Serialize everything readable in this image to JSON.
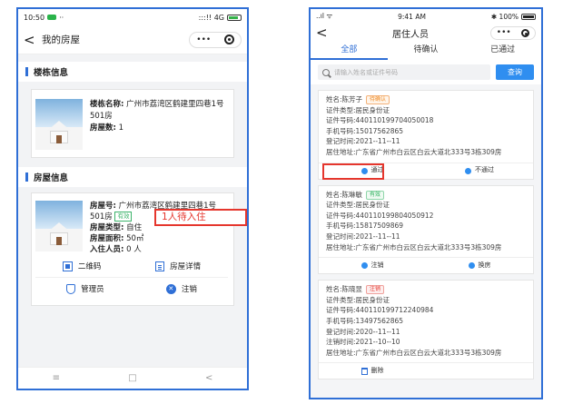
{
  "left": {
    "status": {
      "time": "10:50",
      "dots": "··",
      "signal": ":::!! 4G"
    },
    "nav": {
      "title": "我的房屋"
    },
    "building_section": {
      "title": "楼栋信息"
    },
    "building": {
      "name_label": "楼栋名称:",
      "name_value": "广州市荔湾区鹤建里四巷1号501房",
      "count_label": "房屋数:",
      "count_value": "1"
    },
    "house_section": {
      "title": "房屋信息"
    },
    "house": {
      "no_label": "房屋号:",
      "no_value": "广州市荔湾区鹤建里四巷1号501房",
      "status_tag": "有效",
      "type_label": "房屋类型:",
      "type_value": "自住",
      "area_label": "房屋面积:",
      "area_value": "50㎡",
      "residents_label": "入住人员:",
      "residents_value": "0 人",
      "callout": "1人待入住"
    },
    "actions": {
      "qrcode": "二维码",
      "detail": "房屋详情",
      "admin": "管理员",
      "cancel": "注销"
    },
    "bottom_nav": {
      "menu": "≡",
      "home": "□",
      "back": "<"
    }
  },
  "right": {
    "status": {
      "signal": "..ıl ᯤ",
      "time": "9:41 AM",
      "battery": "✱ 100%"
    },
    "nav": {
      "title": "居住人员"
    },
    "tabs": [
      "全部",
      "待确认",
      "已通过"
    ],
    "search": {
      "placeholder": "请输入姓名或证件号码",
      "button": "查询"
    },
    "persons": [
      {
        "name_line": "姓名:陈芳子",
        "tag": "待确认",
        "id_type": "证件类型:居民身份证",
        "id_no": "证件号码:440110199704050018",
        "phone": "手机号码:15017562865",
        "reg_time": "登记时间:2021--11--11",
        "address": "居住地址:广东省广州市白云区白云大道北333号3栋309房",
        "actions": [
          "通过",
          "不通过"
        ]
      },
      {
        "name_line": "姓名:陈琳敏",
        "tag": "有效",
        "id_type": "证件类型:居民身份证",
        "id_no": "证件号码:440110199804050912",
        "phone": "手机号码:15817509869",
        "reg_time": "登记时间:2021--11--11",
        "address": "居住地址:广东省广州市白云区白云大道北333号3栋309房",
        "actions": [
          "注销",
          "换房"
        ]
      },
      {
        "name_line": "姓名:陈晓昱",
        "tag": "注销",
        "id_type": "证件类型:居民身份证",
        "id_no": "证件号码:440110199712240984",
        "phone": "手机号码:13497562865",
        "reg_time": "登记时间:2020--11--11",
        "cancel_time": "注销时间:2021--10--10",
        "address": "居住地址:广东省广州市白云区白云大道北333号3栋309房",
        "actions": [
          "删除"
        ]
      }
    ]
  },
  "colors": {
    "accent": "#2f6fd6",
    "highlight": "#e5362d",
    "pending": "#f08a24",
    "valid": "#2bb25c"
  }
}
